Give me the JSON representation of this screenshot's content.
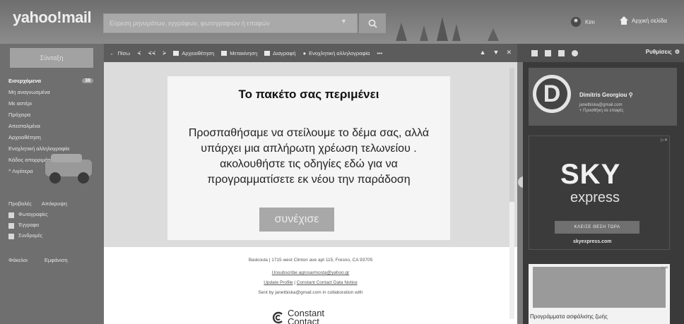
{
  "header": {
    "logo": "yahoo!mail",
    "search_placeholder": "Εύρεση μηνυμάτων, εγγράφων, φωτογραφιών ή επαφών",
    "user_label": "Kim",
    "home_label": "Αρχική σελίδα"
  },
  "sidebar": {
    "compose_label": "Σύνταξη",
    "folders": [
      {
        "label": "Εισερχόμενα",
        "count": "38"
      },
      {
        "label": "Μη αναγνωσμένα"
      },
      {
        "label": "Με αστέρι"
      },
      {
        "label": "Πρόχειρα"
      },
      {
        "label": "Απεσταλμένα"
      },
      {
        "label": "Αρχειοθέτηση"
      },
      {
        "label": "Ενοχλητική αλληλογραφία"
      },
      {
        "label": "Κάδος απορριμάτων"
      },
      {
        "label": "^ Λιγότερα"
      }
    ],
    "views_title": "Προβολές",
    "views_hide": "Απόκρυψη",
    "views": [
      "Φωτογραφίες",
      "Έγγραφα",
      "Συνδρομές"
    ],
    "footer_left": "Φάκελοι",
    "footer_right": "Εμφάνιση"
  },
  "toolbar": {
    "back_label": "Πίσω",
    "archive_label": "Αρχειοθέτηση",
    "move_label": "Μετακίνηση",
    "delete_label": "Διαγραφή",
    "spam_label": "Ενοχλητική αλληλογραφία",
    "more_label": "•••",
    "close_label": "✕"
  },
  "right_toolbar": {
    "settings_label": "Ρυθμίσεις"
  },
  "message": {
    "heading": "Το πακέτο σας περιμένει",
    "body": "Προσπαθήσαμε να στείλουμε το δέμα σας, αλλά υπάρχει μια απλήρωτη χρέωση τελωνείου . ακολουθήστε τις οδηγίες εδώ για να προγραμματίσετε εκ νέου την παράδοση",
    "cta_label": "συνέχισε",
    "footer_address": "Baskouta | 1715 west Clinton ave apt 115, Fresno, CA 93705",
    "footer_unsubscribe": "Unsubscribe agrosarmosta@yahoo.gr",
    "footer_update": "Update Profile",
    "footer_separator": "|",
    "footer_notice": "Constant Contact Data Notice",
    "footer_sent": "Sent by janetbiska@gmail.com in collaboration with",
    "cc_logo_line1": "Constant",
    "cc_logo_line2": "Contact"
  },
  "profile": {
    "initial": "D",
    "name": "Dimitris Georgiou",
    "email": "janetbiska@gmail.com",
    "add_label": "+ Προσθήκη σε επαφές"
  },
  "ads": {
    "sky_big": "SKY",
    "sky_small": "express",
    "sky_button": "ΚΛΕΙΣΕ ΘΕΣΗ ΤΩΡΑ",
    "sky_url": "skyexpress.com",
    "ad_marker": "▷✕",
    "insurance_text": "Προγράμματα ασφάλισης ζωής"
  }
}
